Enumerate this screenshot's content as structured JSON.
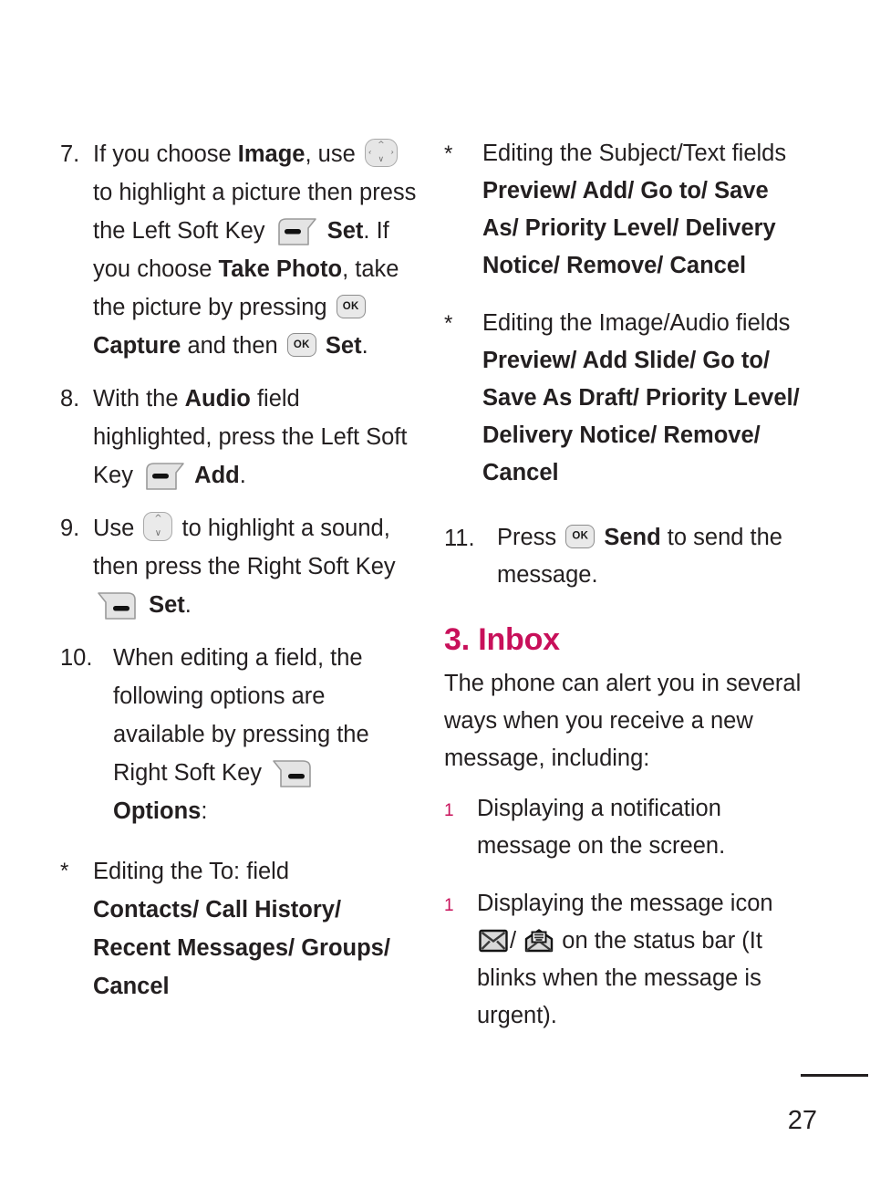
{
  "document": {
    "page_number": "27",
    "accent_color": "#c8105a",
    "text_color": "#231f20"
  },
  "left_column": {
    "steps": [
      {
        "marker": "7.",
        "segments": [
          {
            "t": "text",
            "v": "If you choose "
          },
          {
            "t": "bold",
            "v": "Image"
          },
          {
            "t": "text",
            "v": ", use "
          },
          {
            "t": "icon",
            "v": "nav-4way-key-icon"
          },
          {
            "t": "text",
            "v": " to highlight a picture then press the Left Soft Key "
          },
          {
            "t": "icon",
            "v": "left-soft-key-icon"
          },
          {
            "t": "bold",
            "v": " Set"
          },
          {
            "t": "text",
            "v": ". If you choose "
          },
          {
            "t": "bold",
            "v": "Take Photo"
          },
          {
            "t": "text",
            "v": ", take the picture by pressing "
          },
          {
            "t": "icon",
            "v": "ok-key-icon"
          },
          {
            "t": "bold",
            "v": " Capture"
          },
          {
            "t": "text",
            "v": " and then "
          },
          {
            "t": "icon",
            "v": "ok-key-icon"
          },
          {
            "t": "bold",
            "v": " Set"
          },
          {
            "t": "text",
            "v": "."
          }
        ]
      },
      {
        "marker": "8.",
        "segments": [
          {
            "t": "text",
            "v": "With the "
          },
          {
            "t": "bold",
            "v": "Audio"
          },
          {
            "t": "text",
            "v": " field highlighted, press the Left Soft Key "
          },
          {
            "t": "icon",
            "v": "left-soft-key-icon"
          },
          {
            "t": "bold",
            "v": " Add"
          },
          {
            "t": "text",
            "v": "."
          }
        ]
      },
      {
        "marker": "9.",
        "segments": [
          {
            "t": "text",
            "v": "Use "
          },
          {
            "t": "icon",
            "v": "nav-updown-key-icon"
          },
          {
            "t": "text",
            "v": " to highlight a sound, then press the Right Soft Key "
          },
          {
            "t": "icon",
            "v": "right-soft-key-icon"
          },
          {
            "t": "bold",
            "v": " Set"
          },
          {
            "t": "text",
            "v": "."
          }
        ]
      },
      {
        "marker": "10.",
        "segments": [
          {
            "t": "text",
            "v": "When editing a field, the following options are available by pressing the Right Soft Key "
          },
          {
            "t": "icon",
            "v": "right-soft-key-icon"
          },
          {
            "t": "break",
            "v": ""
          },
          {
            "t": "bold",
            "v": "Options"
          },
          {
            "t": "text",
            "v": ":"
          }
        ]
      },
      {
        "marker": "*",
        "segments": [
          {
            "t": "text",
            "v": "Editing the To: field"
          },
          {
            "t": "break",
            "v": ""
          },
          {
            "t": "bold",
            "v": "Contacts/ Call History/ Recent Messages/ Groups/ Cancel"
          }
        ]
      }
    ]
  },
  "right_column": {
    "steps": [
      {
        "marker": "*",
        "segments": [
          {
            "t": "text",
            "v": "Editing the Subject/Text fields"
          },
          {
            "t": "break",
            "v": ""
          },
          {
            "t": "bold",
            "v": "Preview/ Add/ Go to/ Save As/ Priority Level/ Delivery Notice/ Remove/ Cancel"
          }
        ]
      },
      {
        "marker": "*",
        "segments": [
          {
            "t": "text",
            "v": "Editing the Image/Audio fields"
          },
          {
            "t": "break",
            "v": ""
          },
          {
            "t": "bold",
            "v": "Preview/ Add Slide/ Go to/ Save As Draft/ Priority Level/ Delivery Notice/ Remove/ Cancel"
          }
        ]
      },
      {
        "marker": "11.",
        "segments": [
          {
            "t": "text",
            "v": "Press "
          },
          {
            "t": "icon",
            "v": "ok-key-icon"
          },
          {
            "t": "bold",
            "v": " Send"
          },
          {
            "t": "text",
            "v": " to send the message."
          }
        ]
      }
    ],
    "section": {
      "heading": "3. Inbox",
      "intro": "The phone can alert you in several ways when you receive a new message, including:",
      "bullets": [
        {
          "marker": "1",
          "segments": [
            {
              "t": "text",
              "v": "Displaying a notification message on the screen."
            }
          ]
        },
        {
          "marker": "1",
          "segments": [
            {
              "t": "text",
              "v": "Displaying the message icon "
            },
            {
              "t": "icon",
              "v": "envelope-closed-icon"
            },
            {
              "t": "text",
              "v": "/ "
            },
            {
              "t": "icon",
              "v": "envelope-open-letter-icon"
            },
            {
              "t": "text",
              "v": " on the status bar (It blinks when the message is urgent)."
            }
          ]
        }
      ]
    }
  }
}
